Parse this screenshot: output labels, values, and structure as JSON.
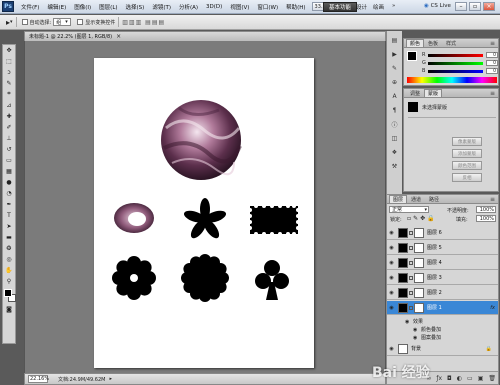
{
  "menubar": {
    "logo": "Ps",
    "items": [
      "文件(F)",
      "编辑(E)",
      "图像(I)",
      "图层(L)",
      "选择(S)",
      "滤镜(T)",
      "分析(A)",
      "3D(D)",
      "视图(V)",
      "窗口(W)",
      "帮助(H)"
    ],
    "zoom_btn": "33.3",
    "workspace": "基本功能",
    "ws_links": [
      "设计",
      "绘画"
    ],
    "cslive": "CS Live"
  },
  "options": {
    "tool_glyph": "▸",
    "checkbox_label": "自动选择:",
    "select_value": "组",
    "transform_label": "显示变换控件"
  },
  "document": {
    "tab_label": "未标题-1 @ 22.2% (图层 1, RGB/8)",
    "zoom": "22.16%",
    "doc_info": "文档:24.9M/49.62M"
  },
  "color_panel": {
    "tabs": [
      "颜色",
      "色板",
      "样式"
    ],
    "channels": [
      {
        "label": "R",
        "value": "0",
        "gradient": "linear-gradient(to right, #000, #ff0000)"
      },
      {
        "label": "G",
        "value": "0",
        "gradient": "linear-gradient(to right, #000, #00ff00)"
      },
      {
        "label": "B",
        "value": "0",
        "gradient": "linear-gradient(to right, #000, #0000ff)"
      }
    ]
  },
  "adjust_panel": {
    "tabs": [
      "调整",
      "蒙版"
    ],
    "title": "未选择蒙版",
    "buttons": [
      "像素蒙版",
      "添加蒙版",
      "颜色范围",
      "反相"
    ]
  },
  "layers_panel": {
    "tabs": [
      "图层",
      "通道",
      "路径"
    ],
    "blend_mode": "正常",
    "opacity_label": "不透明度:",
    "opacity_value": "100%",
    "lock_label": "锁定:",
    "fill_label": "填充:",
    "fill_value": "100%",
    "layers": [
      {
        "name": "图层 6",
        "selected": false,
        "fx": false
      },
      {
        "name": "图层 5",
        "selected": false,
        "fx": false
      },
      {
        "name": "图层 4",
        "selected": false,
        "fx": false
      },
      {
        "name": "图层 3",
        "selected": false,
        "fx": false
      },
      {
        "name": "图层 2",
        "selected": false,
        "fx": false
      },
      {
        "name": "图层 1",
        "selected": true,
        "fx": true
      }
    ],
    "effects_label": "效果",
    "effects": [
      "颜色叠加",
      "图案叠加"
    ],
    "fx_text": "fx",
    "background_name": "背景"
  },
  "watermark": "Bai 经验",
  "colors": {
    "selection": "#3a87d6",
    "canvas": "#ffffff",
    "shapes": "#000000",
    "silk": "#b07a9a"
  }
}
